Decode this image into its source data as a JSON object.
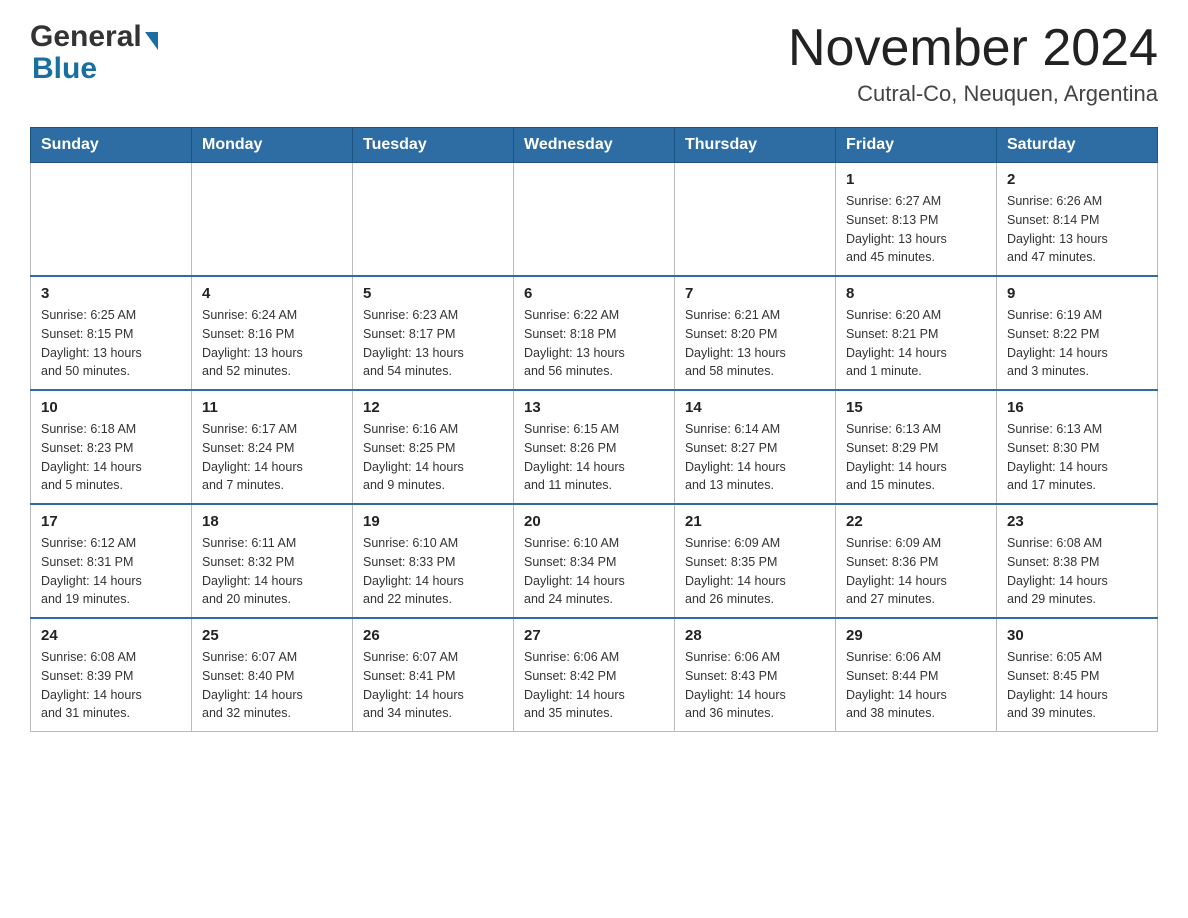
{
  "header": {
    "title": "November 2024",
    "location": "Cutral-Co, Neuquen, Argentina",
    "logo_general": "General",
    "logo_blue": "Blue"
  },
  "weekdays": [
    "Sunday",
    "Monday",
    "Tuesday",
    "Wednesday",
    "Thursday",
    "Friday",
    "Saturday"
  ],
  "weeks": [
    [
      {
        "day": "",
        "info": ""
      },
      {
        "day": "",
        "info": ""
      },
      {
        "day": "",
        "info": ""
      },
      {
        "day": "",
        "info": ""
      },
      {
        "day": "",
        "info": ""
      },
      {
        "day": "1",
        "info": "Sunrise: 6:27 AM\nSunset: 8:13 PM\nDaylight: 13 hours\nand 45 minutes."
      },
      {
        "day": "2",
        "info": "Sunrise: 6:26 AM\nSunset: 8:14 PM\nDaylight: 13 hours\nand 47 minutes."
      }
    ],
    [
      {
        "day": "3",
        "info": "Sunrise: 6:25 AM\nSunset: 8:15 PM\nDaylight: 13 hours\nand 50 minutes."
      },
      {
        "day": "4",
        "info": "Sunrise: 6:24 AM\nSunset: 8:16 PM\nDaylight: 13 hours\nand 52 minutes."
      },
      {
        "day": "5",
        "info": "Sunrise: 6:23 AM\nSunset: 8:17 PM\nDaylight: 13 hours\nand 54 minutes."
      },
      {
        "day": "6",
        "info": "Sunrise: 6:22 AM\nSunset: 8:18 PM\nDaylight: 13 hours\nand 56 minutes."
      },
      {
        "day": "7",
        "info": "Sunrise: 6:21 AM\nSunset: 8:20 PM\nDaylight: 13 hours\nand 58 minutes."
      },
      {
        "day": "8",
        "info": "Sunrise: 6:20 AM\nSunset: 8:21 PM\nDaylight: 14 hours\nand 1 minute."
      },
      {
        "day": "9",
        "info": "Sunrise: 6:19 AM\nSunset: 8:22 PM\nDaylight: 14 hours\nand 3 minutes."
      }
    ],
    [
      {
        "day": "10",
        "info": "Sunrise: 6:18 AM\nSunset: 8:23 PM\nDaylight: 14 hours\nand 5 minutes."
      },
      {
        "day": "11",
        "info": "Sunrise: 6:17 AM\nSunset: 8:24 PM\nDaylight: 14 hours\nand 7 minutes."
      },
      {
        "day": "12",
        "info": "Sunrise: 6:16 AM\nSunset: 8:25 PM\nDaylight: 14 hours\nand 9 minutes."
      },
      {
        "day": "13",
        "info": "Sunrise: 6:15 AM\nSunset: 8:26 PM\nDaylight: 14 hours\nand 11 minutes."
      },
      {
        "day": "14",
        "info": "Sunrise: 6:14 AM\nSunset: 8:27 PM\nDaylight: 14 hours\nand 13 minutes."
      },
      {
        "day": "15",
        "info": "Sunrise: 6:13 AM\nSunset: 8:29 PM\nDaylight: 14 hours\nand 15 minutes."
      },
      {
        "day": "16",
        "info": "Sunrise: 6:13 AM\nSunset: 8:30 PM\nDaylight: 14 hours\nand 17 minutes."
      }
    ],
    [
      {
        "day": "17",
        "info": "Sunrise: 6:12 AM\nSunset: 8:31 PM\nDaylight: 14 hours\nand 19 minutes."
      },
      {
        "day": "18",
        "info": "Sunrise: 6:11 AM\nSunset: 8:32 PM\nDaylight: 14 hours\nand 20 minutes."
      },
      {
        "day": "19",
        "info": "Sunrise: 6:10 AM\nSunset: 8:33 PM\nDaylight: 14 hours\nand 22 minutes."
      },
      {
        "day": "20",
        "info": "Sunrise: 6:10 AM\nSunset: 8:34 PM\nDaylight: 14 hours\nand 24 minutes."
      },
      {
        "day": "21",
        "info": "Sunrise: 6:09 AM\nSunset: 8:35 PM\nDaylight: 14 hours\nand 26 minutes."
      },
      {
        "day": "22",
        "info": "Sunrise: 6:09 AM\nSunset: 8:36 PM\nDaylight: 14 hours\nand 27 minutes."
      },
      {
        "day": "23",
        "info": "Sunrise: 6:08 AM\nSunset: 8:38 PM\nDaylight: 14 hours\nand 29 minutes."
      }
    ],
    [
      {
        "day": "24",
        "info": "Sunrise: 6:08 AM\nSunset: 8:39 PM\nDaylight: 14 hours\nand 31 minutes."
      },
      {
        "day": "25",
        "info": "Sunrise: 6:07 AM\nSunset: 8:40 PM\nDaylight: 14 hours\nand 32 minutes."
      },
      {
        "day": "26",
        "info": "Sunrise: 6:07 AM\nSunset: 8:41 PM\nDaylight: 14 hours\nand 34 minutes."
      },
      {
        "day": "27",
        "info": "Sunrise: 6:06 AM\nSunset: 8:42 PM\nDaylight: 14 hours\nand 35 minutes."
      },
      {
        "day": "28",
        "info": "Sunrise: 6:06 AM\nSunset: 8:43 PM\nDaylight: 14 hours\nand 36 minutes."
      },
      {
        "day": "29",
        "info": "Sunrise: 6:06 AM\nSunset: 8:44 PM\nDaylight: 14 hours\nand 38 minutes."
      },
      {
        "day": "30",
        "info": "Sunrise: 6:05 AM\nSunset: 8:45 PM\nDaylight: 14 hours\nand 39 minutes."
      }
    ]
  ]
}
